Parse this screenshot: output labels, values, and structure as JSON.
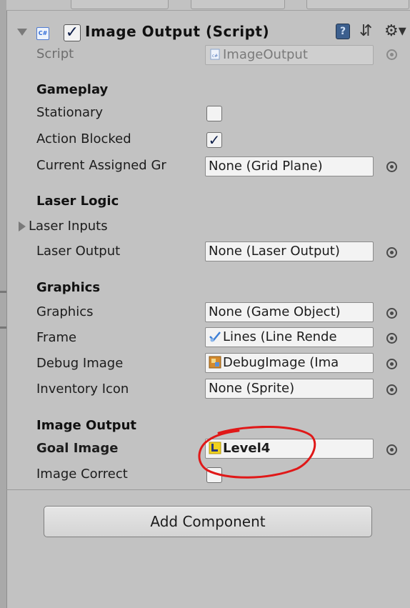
{
  "component": {
    "title": "Image Output (Script)",
    "icon_names": [
      "cs-script-icon",
      "book-help-icon",
      "sliders-icon",
      "gear-icon"
    ]
  },
  "script_row": {
    "label": "Script",
    "value": "ImageOutput"
  },
  "sections": {
    "gameplay": {
      "title": "Gameplay",
      "stationary_label": "Stationary",
      "stationary_checked": false,
      "action_blocked_label": "Action Blocked",
      "action_blocked_checked": true,
      "grid_label": "Current Assigned Gr",
      "grid_value": "None (Grid Plane)"
    },
    "laser_logic": {
      "title": "Laser Logic",
      "inputs_label": "Laser Inputs",
      "output_label": "Laser Output",
      "output_value": "None (Laser Output)"
    },
    "graphics": {
      "title": "Graphics",
      "graphics_label": "Graphics",
      "graphics_value": "None (Game Object)",
      "frame_label": "Frame",
      "frame_value": "Lines (Line Rende",
      "debug_label": "Debug Image",
      "debug_value": "DebugImage (Ima",
      "inventory_label": "Inventory Icon",
      "inventory_value": "None (Sprite)"
    },
    "image_output": {
      "title": "Image Output",
      "goal_label": "Goal Image",
      "goal_value": "Level4",
      "correct_label": "Image Correct",
      "correct_checked": false
    }
  },
  "add_component_label": "Add Component",
  "colors": {
    "panel_bg": "#c2c2c2",
    "field_bg": "#f3f3f3",
    "annotation_red": "#e01818",
    "check_mark": "#0e1f4a"
  }
}
